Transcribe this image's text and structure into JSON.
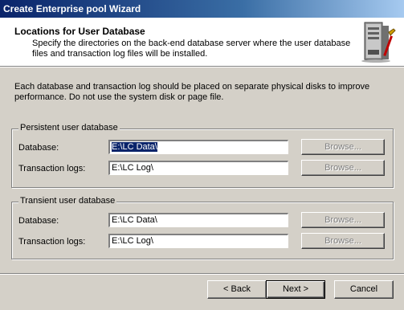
{
  "window": {
    "title": "Create Enterprise pool Wizard"
  },
  "header": {
    "title": "Locations for User Database",
    "description": "Specify the directories on the back-end database server where the user database files and transaction log files will be installed.",
    "icon": "server-icon"
  },
  "intro": "Each database and transaction log should be placed on separate physical disks to improve performance. Do not use the system disk or page file.",
  "persistent": {
    "legend": "Persistent user database",
    "database_label": "Database:",
    "database_value": "E:\\LC Data\\",
    "logs_label": "Transaction logs:",
    "logs_value": "E:\\LC Log\\",
    "browse_label": "Browse..."
  },
  "transient": {
    "legend": "Transient user database",
    "database_label": "Database:",
    "database_value": "E:\\LC Data\\",
    "logs_label": "Transaction logs:",
    "logs_value": "E:\\LC Log\\",
    "browse_label": "Browse..."
  },
  "footer": {
    "back_label": "< Back",
    "next_label": "Next >",
    "cancel_label": "Cancel"
  }
}
